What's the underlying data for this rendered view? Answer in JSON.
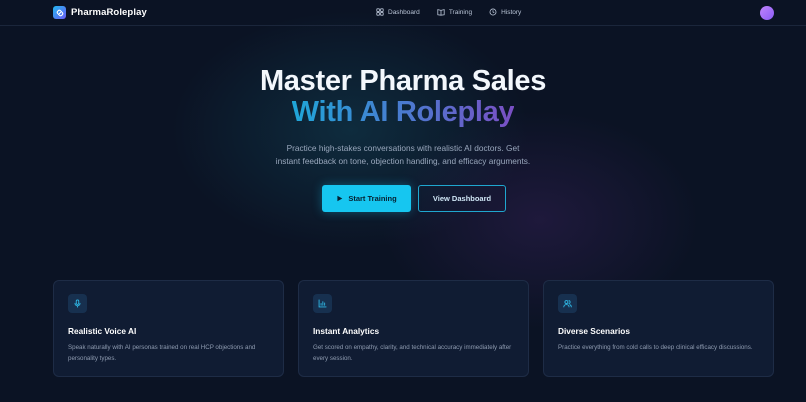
{
  "app": {
    "brand": "PharmaRoleplay"
  },
  "nav": {
    "items": [
      {
        "label": "Dashboard",
        "icon": "dashboard-icon"
      },
      {
        "label": "Training",
        "icon": "book-icon"
      },
      {
        "label": "History",
        "icon": "history-icon"
      }
    ]
  },
  "hero": {
    "title_line1": "Master Pharma Sales",
    "title_line2": "With AI Roleplay",
    "subtitle_line1": "Practice high-stakes conversations with realistic AI doctors. Get",
    "subtitle_line2": "instant feedback on tone, objection handling, and efficacy arguments.",
    "primary_button": "Start Training",
    "secondary_button": "View Dashboard"
  },
  "features": [
    {
      "title": "Realistic Voice AI",
      "desc": "Speak naturally with AI personas trained on real HCP objections and personality types.",
      "icon": "microphone-icon"
    },
    {
      "title": "Instant Analytics",
      "desc": "Get scored on empathy, clarity, and technical accuracy immediately after every session.",
      "icon": "bar-chart-icon"
    },
    {
      "title": "Diverse Scenarios",
      "desc": "Practice everything from cold calls to deep clinical efficacy discussions.",
      "icon": "users-icon"
    }
  ],
  "colors": {
    "background": "#0b1324",
    "accent": "#16c6f0",
    "card": "#101c33",
    "gradient_start": "#1fa6d8",
    "gradient_end": "#7a4fc4"
  }
}
